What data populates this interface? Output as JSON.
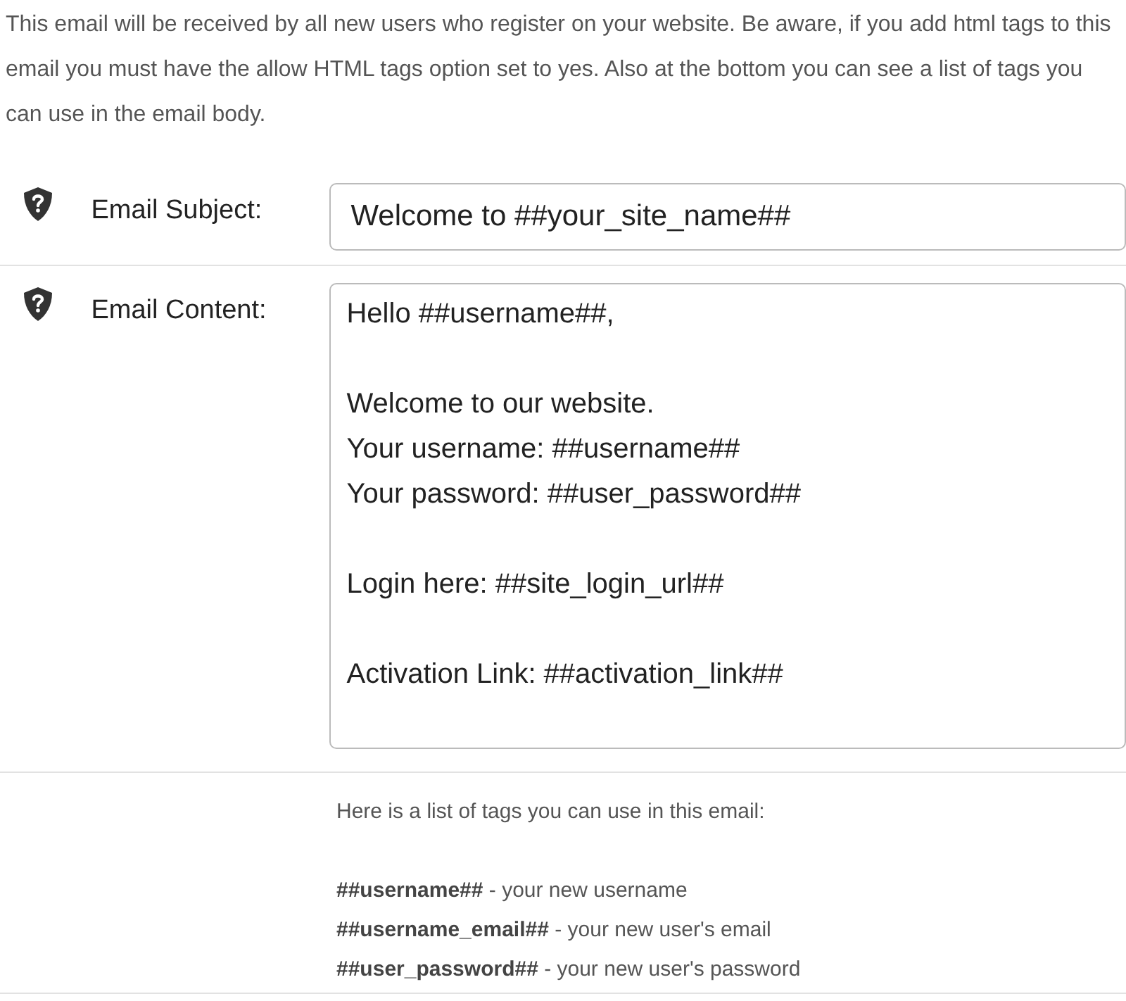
{
  "intro": "This email will be received by all new users who register on your website. Be aware, if you add html tags to this email you must have the allow HTML tags option set to yes. Also at the bottom you can see a list of tags you can use in the email body.",
  "fields": [
    {
      "kind": "input",
      "label": "Email Subject:",
      "value": "Welcome to ##your_site_name##"
    },
    {
      "kind": "textarea",
      "label": "Email Content:",
      "value": "Hello ##username##,\n\nWelcome to our website.\nYour username: ##username##\nYour password: ##user_password##\n\nLogin here: ##site_login_url##\n\nActivation Link: ##activation_link##"
    }
  ],
  "tags_heading": "Here is a list of tags you can use in this email:",
  "tags": [
    "**##username##** - your new username",
    "**##username_email##** - your new user's email",
    "**##user_password##** - your new user's password"
  ]
}
